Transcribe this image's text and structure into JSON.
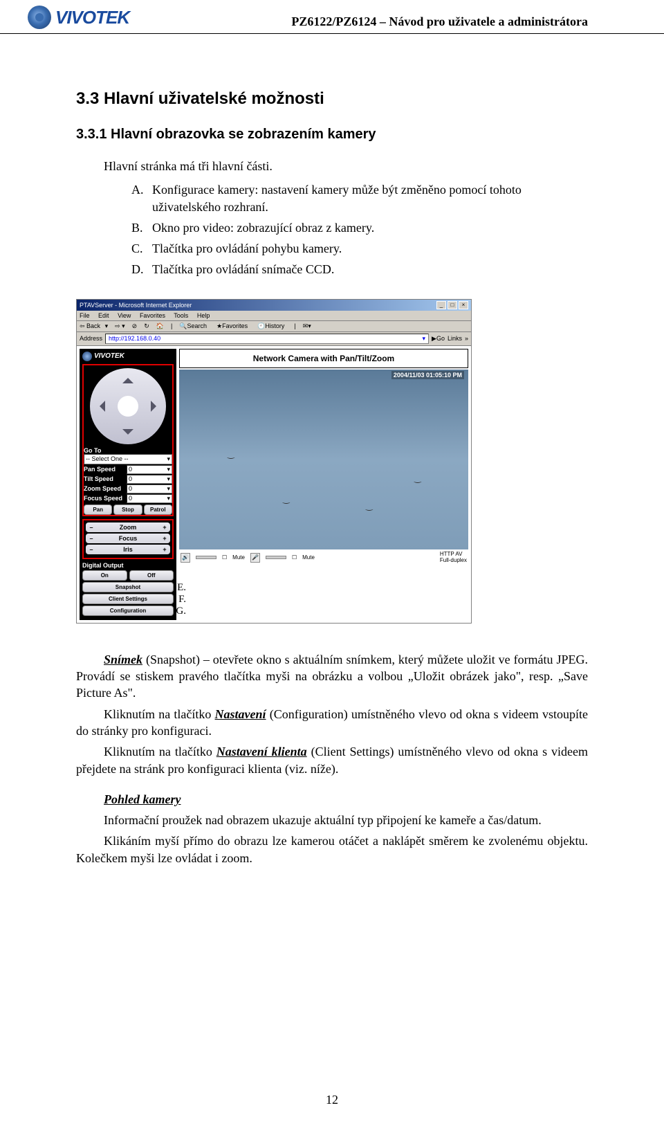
{
  "header": {
    "logo_text": "VIVOTEK",
    "doc_title": "PZ6122/PZ6124 – Návod pro uživatele a administrátora"
  },
  "section": {
    "num_title": "3.3  Hlavní uživatelské možnosti",
    "sub_num_title": "3.3.1  Hlavní obrazovka se zobrazením kamery",
    "intro": "Hlavní stránka má tři hlavní části.",
    "list": [
      {
        "letter": "A.",
        "text": "Konfigurace kamery: nastavení kamery může být změněno pomocí tohoto uživatelského rozhraní."
      },
      {
        "letter": "B.",
        "text": "Okno pro video: zobrazující obraz z kamery."
      },
      {
        "letter": "C.",
        "text": "Tlačítka pro ovládání pohybu kamery."
      },
      {
        "letter": "D.",
        "text": "Tlačítka pro ovládání snímače CCD."
      }
    ]
  },
  "screenshot": {
    "window_title": "PTAVServer - Microsoft Internet Explorer",
    "menu": [
      "File",
      "Edit",
      "View",
      "Favorites",
      "Tools",
      "Help"
    ],
    "toolbar": {
      "back": "Back",
      "search": "Search",
      "favorites": "Favorites",
      "history": "History",
      "arrow": "▾",
      "sep": "|"
    },
    "address_label": "Address",
    "address_val": "http://192.168.0.40",
    "go": "Go",
    "links": "Links",
    "logo": "VIVOTEK",
    "video_title": "Network Camera with Pan/Tilt/Zoom",
    "timestamp": "2004/11/03 01:05:10 PM",
    "goto_label": "Go To",
    "goto_sel": "-- Select One --",
    "speeds": [
      {
        "label": "Pan Speed",
        "val": "0"
      },
      {
        "label": "Tilt Speed",
        "val": "0"
      },
      {
        "label": "Zoom Speed",
        "val": "0"
      },
      {
        "label": "Focus Speed",
        "val": "0"
      }
    ],
    "pst": [
      "Pan",
      "Stop",
      "Patrol"
    ],
    "sliders": [
      "Zoom",
      "Focus",
      "Iris"
    ],
    "digital_output": "Digital Output",
    "on": "On",
    "off": "Off",
    "snapshot": "Snapshot",
    "client_settings": "Client Settings",
    "configuration": "Configuration",
    "marks": {
      "e": "E.",
      "f": "F.",
      "g": "G."
    },
    "mute": "Mute",
    "httpav": "HTTP  AV",
    "duplex": "Full-duplex",
    "caret": "▾",
    "minus": "–",
    "plus": "+"
  },
  "body": {
    "p1_lead": "Snímek",
    "p1_rest": " (Snapshot) – otevřete okno s aktuálním snímkem, který můžete uložit ve formátu JPEG. Provádí se stiskem pravého tlačítka myši na obrázku a volbou „Uložit obrázek jako\", resp. „Save Picture As\".",
    "p2_a": "Kliknutím na tlačítko ",
    "p2_b": "Nastavení",
    "p2_c": " (Configuration) umístněného vlevo od okna s videem vstoupíte do stránky pro konfiguraci.",
    "p3_a": "Kliknutím na tlačítko ",
    "p3_b": "Nastavení klienta",
    "p3_c": " (Client Settings) umístněného vlevo od okna s videem přejdete na stránk pro konfiguraci klienta (viz. níže).",
    "p4_head": "Pohled kamery",
    "p4": "Informační proužek nad obrazem ukazuje aktuální typ připojení ke kameře a čas/datum.",
    "p5": "Klikáním myší přímo do obrazu lze kamerou otáčet a naklápět směrem ke zvolenému objektu. Kolečkem myši lze ovládat i zoom."
  },
  "page_number": "12"
}
